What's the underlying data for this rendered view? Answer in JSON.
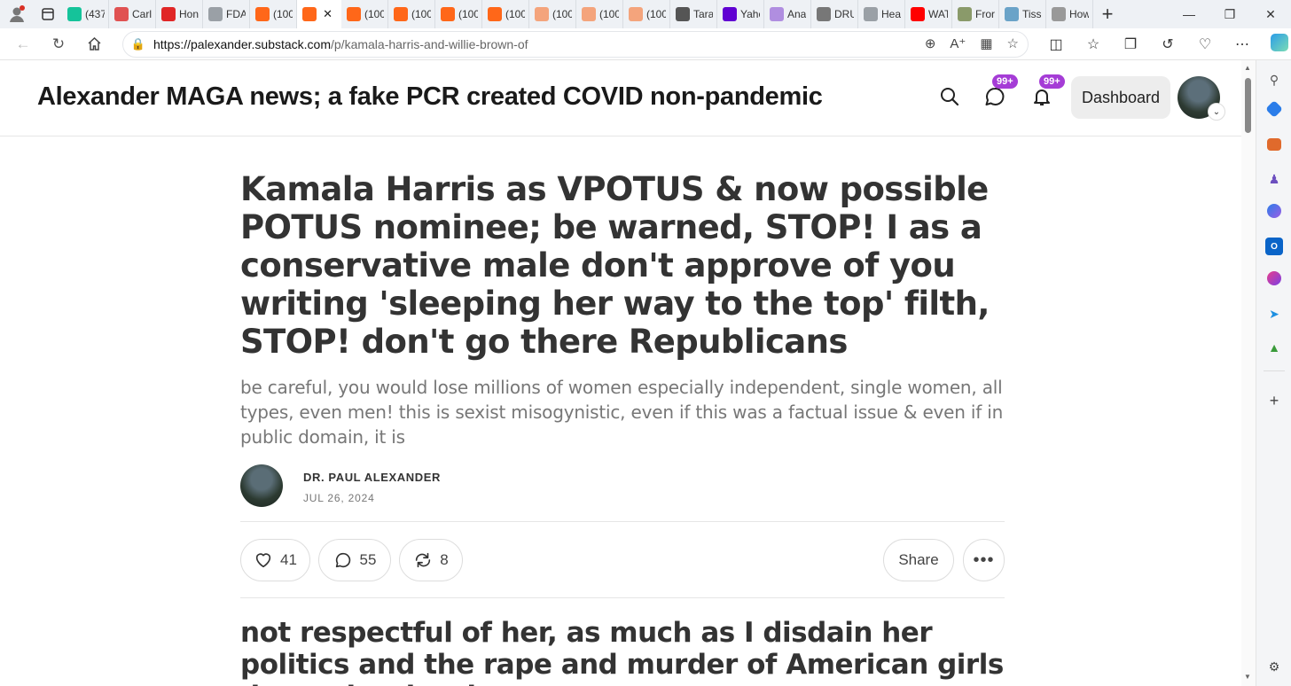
{
  "browser": {
    "tabs": [
      {
        "label": "(437",
        "icon": "grammarly-icon",
        "color": "#15c39a"
      },
      {
        "label": "Carl",
        "icon": "youtube-icon",
        "color": "#e05252"
      },
      {
        "label": "Hon",
        "icon": "bookmark-icon",
        "color": "#e02626"
      },
      {
        "label": "FDA",
        "icon": "page-icon",
        "color": "#9aa0a6"
      },
      {
        "label": "(100",
        "icon": "substack-icon",
        "color": "#ff6719"
      },
      {
        "label": "",
        "icon": "substack-icon",
        "color": "#ff6719",
        "active": true
      },
      {
        "label": "(100",
        "icon": "substack-icon",
        "color": "#ff6719"
      },
      {
        "label": "(100",
        "icon": "substack-icon",
        "color": "#ff6719"
      },
      {
        "label": "(100",
        "icon": "substack-icon",
        "color": "#ff6719"
      },
      {
        "label": "(100",
        "icon": "substack-icon",
        "color": "#ff6719"
      },
      {
        "label": "(100",
        "icon": "substack-icon",
        "color": "#f4a47c"
      },
      {
        "label": "(100",
        "icon": "substack-icon",
        "color": "#f4a47c"
      },
      {
        "label": "(100",
        "icon": "substack-icon",
        "color": "#f4a47c"
      },
      {
        "label": "Tara",
        "icon": "x-icon",
        "color": "#555"
      },
      {
        "label": "Yaho",
        "icon": "yahoo-icon",
        "color": "#6001d2"
      },
      {
        "label": "Ana",
        "icon": "yahoo-icon",
        "color": "#b08ee0"
      },
      {
        "label": "DRU",
        "icon": "drudge-icon",
        "color": "#777"
      },
      {
        "label": "Hea",
        "icon": "page-icon",
        "color": "#9aa0a6"
      },
      {
        "label": "WAT",
        "icon": "youtube-icon",
        "color": "#ff0000"
      },
      {
        "label": "Fror",
        "icon": "image-icon",
        "color": "#8a9a6a"
      },
      {
        "label": "Tiss",
        "icon": "globe-icon",
        "color": "#6aa3c8"
      },
      {
        "label": "How",
        "icon": "globe-icon",
        "color": "#999"
      }
    ],
    "url_host": "https://palexander.substack.com",
    "url_path": "/p/kamala-harris-and-willie-brown-of"
  },
  "site": {
    "title": "Alexander MAGA news; a fake PCR created COVID non-pandemic",
    "chat_badge": "99+",
    "notif_badge": "99+",
    "dashboard_label": "Dashboard"
  },
  "post": {
    "headline": "Kamala Harris as VPOTUS & now possible POTUS nominee; be warned, STOP! I as a conservative male don't approve of you writing 'sleeping her way to the top' filth, STOP! don't go there Republicans",
    "subtitle": "be careful, you would lose millions of women especially independent, single women, all types, even men! this is sexist misogynistic, even if this was a factual issue & even if in public domain, it is",
    "author": "DR. PAUL ALEXANDER",
    "date": "JUL 26, 2024",
    "likes": "41",
    "comments": "55",
    "restacks": "8",
    "share_label": "Share",
    "body_heading": "not respectful of her, as much as I disdain her politics and the rape and murder of American girls due to her border"
  }
}
